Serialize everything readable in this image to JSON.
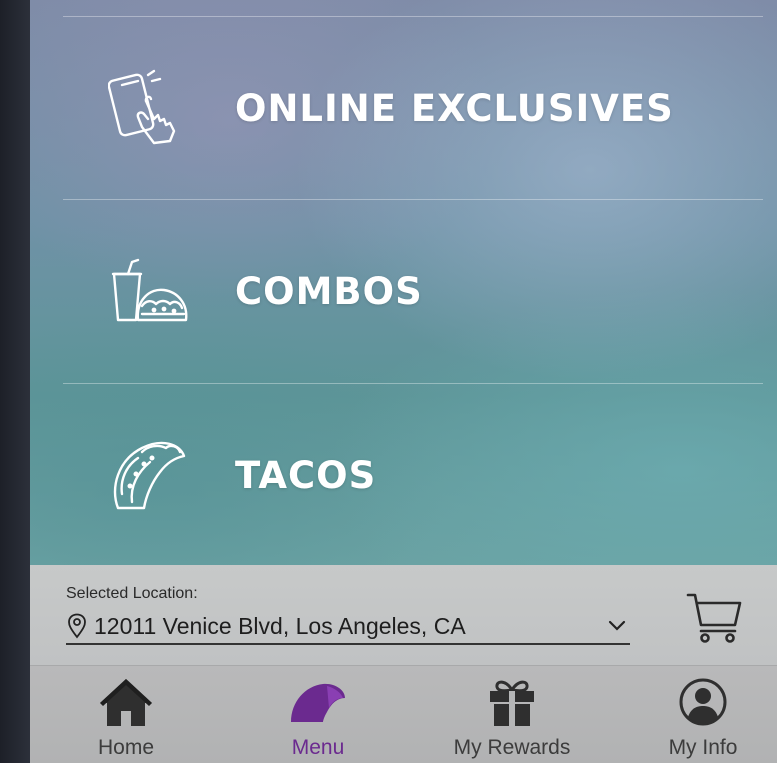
{
  "menu": {
    "items": [
      {
        "label": "ONLINE EXCLUSIVES",
        "icon": "phone-tap-icon"
      },
      {
        "label": "COMBOS",
        "icon": "drink-taco-icon"
      },
      {
        "label": "TACOS",
        "icon": "taco-icon"
      }
    ]
  },
  "location": {
    "caption": "Selected Location:",
    "address": "12011 Venice Blvd, Los Angeles, CA"
  },
  "tabs": [
    {
      "label": "Home",
      "icon": "home-icon",
      "active": false
    },
    {
      "label": "Menu",
      "icon": "taco-shell-icon",
      "active": true
    },
    {
      "label": "My Rewards",
      "icon": "gift-icon",
      "active": false
    },
    {
      "label": "My Info",
      "icon": "user-icon",
      "active": false
    }
  ],
  "colors": {
    "active_tab": "#6b2a8f",
    "tab_icon": "#2f2f2f",
    "menu_text": "#ffffff"
  }
}
